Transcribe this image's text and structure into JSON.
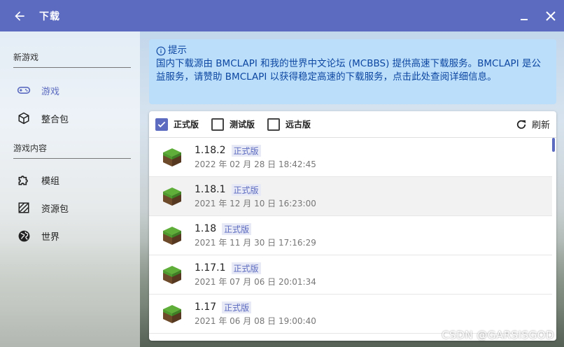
{
  "window": {
    "title": "下载"
  },
  "sidebar": {
    "sections": [
      {
        "header": "新游戏",
        "items": [
          {
            "label": "游戏",
            "icon": "gamepad-icon",
            "active": true
          },
          {
            "label": "整合包",
            "icon": "package-icon",
            "active": false
          }
        ]
      },
      {
        "header": "游戏内容",
        "items": [
          {
            "label": "模组",
            "icon": "puzzle-icon",
            "active": false
          },
          {
            "label": "资源包",
            "icon": "texture-icon",
            "active": false
          },
          {
            "label": "世界",
            "icon": "globe-icon",
            "active": false
          }
        ]
      }
    ]
  },
  "notice": {
    "title": "提示",
    "text": "国内下载源由 BMCLAPI 和我的世界中文论坛 (MCBBS) 提供高速下载服务。BMCLAPI 是公益服务，请赞助 BMCLAPI 以获得稳定高速的下载服务，点击此处查阅详细信息。"
  },
  "filters": {
    "release": {
      "label": "正式版",
      "checked": true
    },
    "snapshot": {
      "label": "测试版",
      "checked": false
    },
    "old": {
      "label": "远古版",
      "checked": false
    },
    "refresh_label": "刷新"
  },
  "versions": [
    {
      "version": "1.18.2",
      "tag": "正式版",
      "date": "2022 年 02 月 28 日 18:42:45"
    },
    {
      "version": "1.18.1",
      "tag": "正式版",
      "date": "2021 年 12 月 10 日 16:23:00"
    },
    {
      "version": "1.18",
      "tag": "正式版",
      "date": "2021 年 11 月 30 日 17:16:29"
    },
    {
      "version": "1.17.1",
      "tag": "正式版",
      "date": "2021 年 07 月 06 日 20:01:34"
    },
    {
      "version": "1.17",
      "tag": "正式版",
      "date": "2021 年 06 月 08 日 19:00:40"
    }
  ],
  "watermark": "CSDN @GARSISGOD",
  "colors": {
    "accent": "#5c6bc0",
    "notice_bg": "#bbdefb",
    "notice_text": "#0d47a1"
  }
}
